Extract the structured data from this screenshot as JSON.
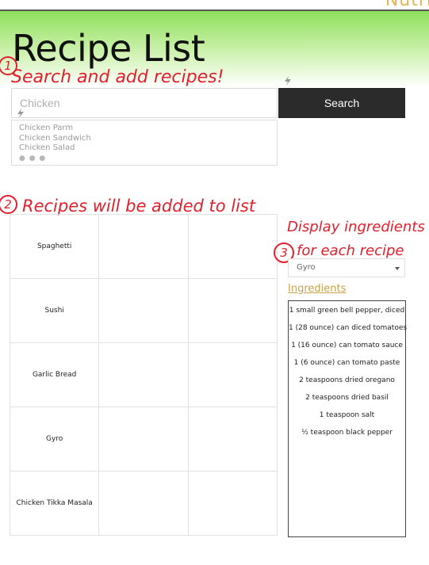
{
  "brand": "Nutri",
  "title": "Recipe List",
  "annotations": {
    "step1_number": "1",
    "step1": "Search and add recipes!",
    "step2_number": "2",
    "step2": "Recipes will be added to list",
    "step3_number": "3",
    "step3_line1": "Display ingredients",
    "step3_line2": "for each recipe"
  },
  "search": {
    "placeholder": "Chicken",
    "button_label": "Search",
    "suggestions": [
      "Chicken Parm",
      "Chicken Sandwich",
      "Chicken Salad"
    ],
    "more_indicator": "● ● ●"
  },
  "recipes": [
    "Spaghetti",
    "Sushi",
    "Garlic Bread",
    "Gyro",
    "Chicken Tikka Masala"
  ],
  "selected_recipe": "Gyro",
  "ingredients_heading": "Ingredients",
  "ingredients": [
    "1 small green bell pepper, diced",
    "1 (28 ounce) can diced tomatoes",
    "1 (16 ounce) can tomato sauce",
    "1 (6 ounce) can tomato paste",
    "2 teaspoons dried oregano",
    "2 teaspoons dried basil",
    "1 teaspoon salt",
    "½ teaspoon black pepper"
  ],
  "colors": {
    "header_green": "#8ee05c",
    "annotation_red": "#e0212d",
    "button_dark": "#2b2b2b",
    "heading_gold": "#c9a24a"
  },
  "icons": [
    "lightning-icon",
    "chevron-down-icon"
  ]
}
